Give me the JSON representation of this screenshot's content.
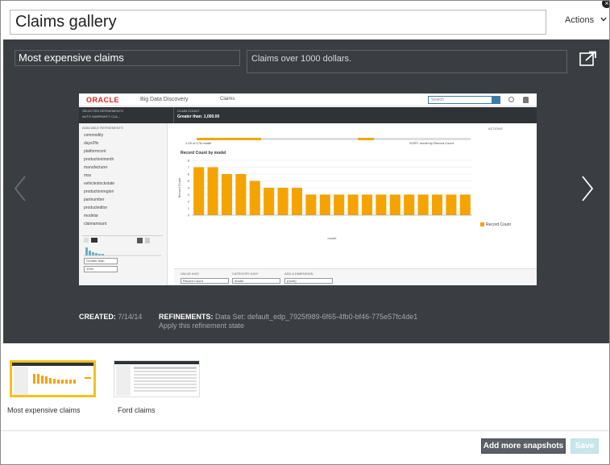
{
  "header": {
    "title": "Claims gallery",
    "actions_label": "Actions",
    "close_glyph": "×"
  },
  "snapshot": {
    "name": "Most expensive claims",
    "description": "Claims over 1000 dollars.",
    "created_label": "CREATED:",
    "created_value": "7/14/14",
    "refinements_label": "REFINEMENTS:",
    "refinements_value": "Data Set: default_edp_7925f989-6f65-4fb0-bf46-775e57fc4de1",
    "apply_link": "Apply this refinement state"
  },
  "preview": {
    "brand": "ORACLE",
    "product": "Big Data Discovery",
    "tab": "Claims",
    "search_placeholder": "Search",
    "selected_refinements": "SELECTED REFINEMENTS",
    "refinement_item": "AUTO WARRANTY CLA...",
    "claim_count_label": "CLAIM COUNT",
    "claim_count_value": "Greater than: 1,000.00",
    "available_refinements": "AVAILABLE REFINEMENTS",
    "refinement_list": [
      "commodity",
      "days2fix",
      "platformcont",
      "productionmonth",
      "manufacturer",
      "mss",
      "vehiclestockstate",
      "productionregion",
      "partnumber",
      "producteditor",
      "modelar",
      "claimamount"
    ],
    "filter_select": "Greater than",
    "filter_input": "1000",
    "actions_mini": "ACTIONS",
    "paging": "1-20 of 176 model",
    "sort_label": "SORT: model by Record Count",
    "footer_value_axis": "VALUE AXIS",
    "footer_category_axis": "CATEGORY AXIS",
    "footer_series": "ADD A DIMENSION",
    "footer_value_select": "Record Count",
    "footer_category_select": "model",
    "footer_series_select": "(none)"
  },
  "chart_data": {
    "type": "bar",
    "title": "Record Count by model",
    "xlabel": "model",
    "ylabel": "Record Count",
    "ylim": [
      0,
      8
    ],
    "yticks": [
      0,
      1,
      2,
      3,
      4,
      5,
      6,
      7,
      8
    ],
    "series": [
      {
        "name": "Record Count",
        "values": [
          7,
          7,
          6,
          6,
          5,
          4,
          4,
          4,
          3,
          3,
          3,
          3,
          3,
          3,
          3,
          3,
          3,
          3,
          3,
          3
        ]
      }
    ],
    "legend": "right"
  },
  "gallery": {
    "items": [
      {
        "label": "Most expensive claims",
        "selected": true
      },
      {
        "label": "Ford claims",
        "selected": false
      }
    ]
  },
  "footer": {
    "add_label": "Add more snapshots",
    "save_label": "Save"
  },
  "colors": {
    "stage_bg": "#3a3e43",
    "bar": "#f5a300",
    "selected_border": "#f4c21a",
    "save_disabled": "#c8e6ea"
  }
}
